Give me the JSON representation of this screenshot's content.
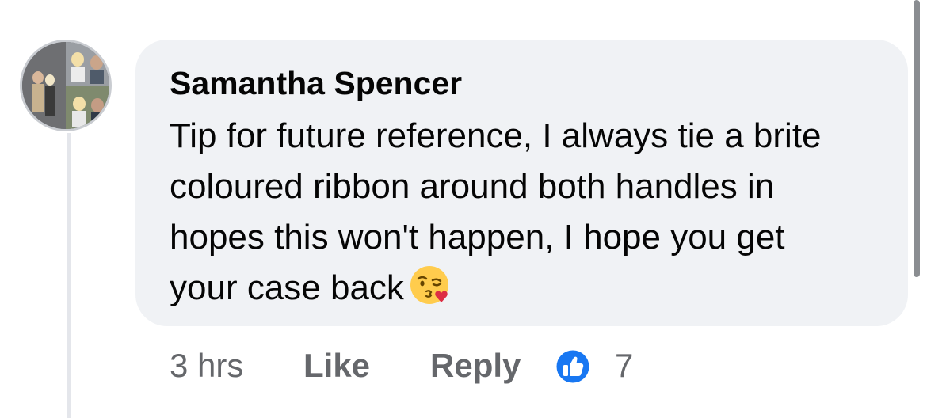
{
  "comment": {
    "author": "Samantha Spencer",
    "text_lines": [
      "Tip for future reference, I always tie a brite",
      "coloured ribbon around both handles in",
      "hopes this won't happen, I hope you get",
      "your case back"
    ],
    "emoji": "face-blowing-a-kiss",
    "time": "3 hrs",
    "like_label": "Like",
    "reply_label": "Reply",
    "reaction_icon": "thumbs-up-icon",
    "reaction_count": "7"
  },
  "colors": {
    "bubble": "#f0f2f5",
    "text": "#050505",
    "meta": "#65676b",
    "like_blue": "#1877f2",
    "thread_line": "#e4e6eb"
  }
}
